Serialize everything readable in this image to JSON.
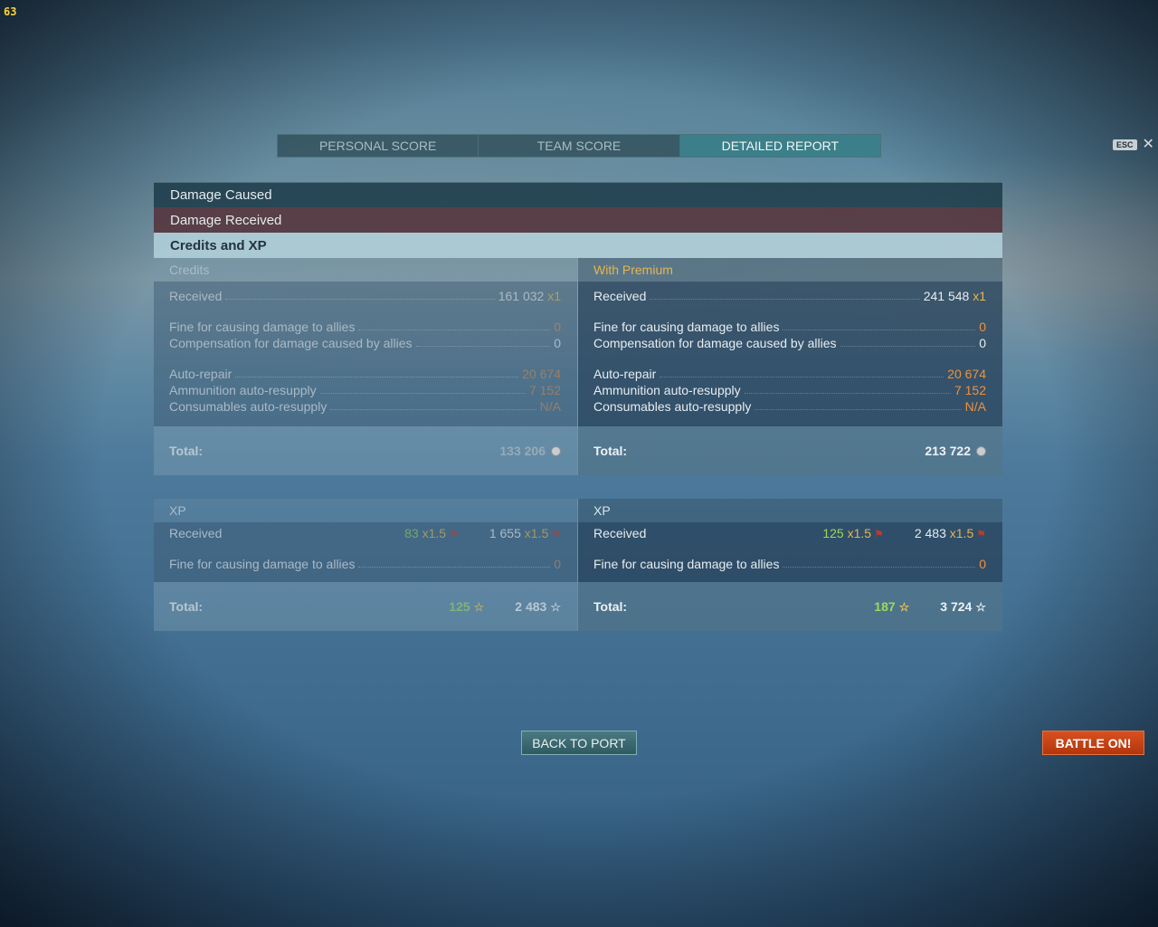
{
  "hud": {
    "fps": "63"
  },
  "tabs": [
    {
      "label": "PERSONAL SCORE",
      "active": false
    },
    {
      "label": "TEAM SCORE",
      "active": false
    },
    {
      "label": "DETAILED REPORT",
      "active": true
    }
  ],
  "close": {
    "key": "ESC",
    "icon": "close-icon"
  },
  "sections": {
    "damage_caused": "Damage Caused",
    "damage_received": "Damage Received",
    "credits_xp": "Credits and XP"
  },
  "credits": {
    "base": {
      "heading": "Credits",
      "received_label": "Received",
      "received_value": "161 032",
      "received_mult": "x1",
      "fine_label": "Fine for causing damage to allies",
      "fine_value": "0",
      "comp_label": "Compensation for damage caused by allies",
      "comp_value": "0",
      "repair_label": "Auto-repair",
      "repair_value": "20 674",
      "ammo_label": "Ammunition auto-resupply",
      "ammo_value": "7 152",
      "cons_label": "Consumables auto-resupply",
      "cons_value": "N/A",
      "total_label": "Total:",
      "total_value": "133 206"
    },
    "premium": {
      "heading": "With Premium",
      "received_label": "Received",
      "received_value": "241 548",
      "received_mult": "x1",
      "fine_label": "Fine for causing damage to allies",
      "fine_value": "0",
      "comp_label": "Compensation for damage caused by allies",
      "comp_value": "0",
      "repair_label": "Auto-repair",
      "repair_value": "20 674",
      "ammo_label": "Ammunition auto-resupply",
      "ammo_value": "7 152",
      "cons_label": "Consumables auto-resupply",
      "cons_value": "N/A",
      "total_label": "Total:",
      "total_value": "213 722"
    }
  },
  "xp": {
    "base": {
      "heading": "XP",
      "received_label": "Received",
      "ship_xp": "83",
      "ship_mult": "x1.5",
      "commander_xp": "1 655",
      "commander_mult": "x1.5",
      "fine_label": "Fine for causing damage to allies",
      "fine_value": "0",
      "total_label": "Total:",
      "total_ship": "125",
      "total_commander": "2 483"
    },
    "premium": {
      "heading": "XP",
      "received_label": "Received",
      "ship_xp": "125",
      "ship_mult": "x1.5",
      "commander_xp": "2 483",
      "commander_mult": "x1.5",
      "fine_label": "Fine for causing damage to allies",
      "fine_value": "0",
      "total_label": "Total:",
      "total_ship": "187",
      "total_commander": "3 724"
    }
  },
  "buttons": {
    "back_to_port": "BACK TO PORT",
    "battle_on": "BATTLE ON!"
  },
  "colors": {
    "accent_teal": "#3c8c96",
    "premium_gold": "#e7b54d",
    "penalty_orange": "#f0913c",
    "xp_green": "#9ed85a",
    "battle_red": "#c8421a"
  }
}
